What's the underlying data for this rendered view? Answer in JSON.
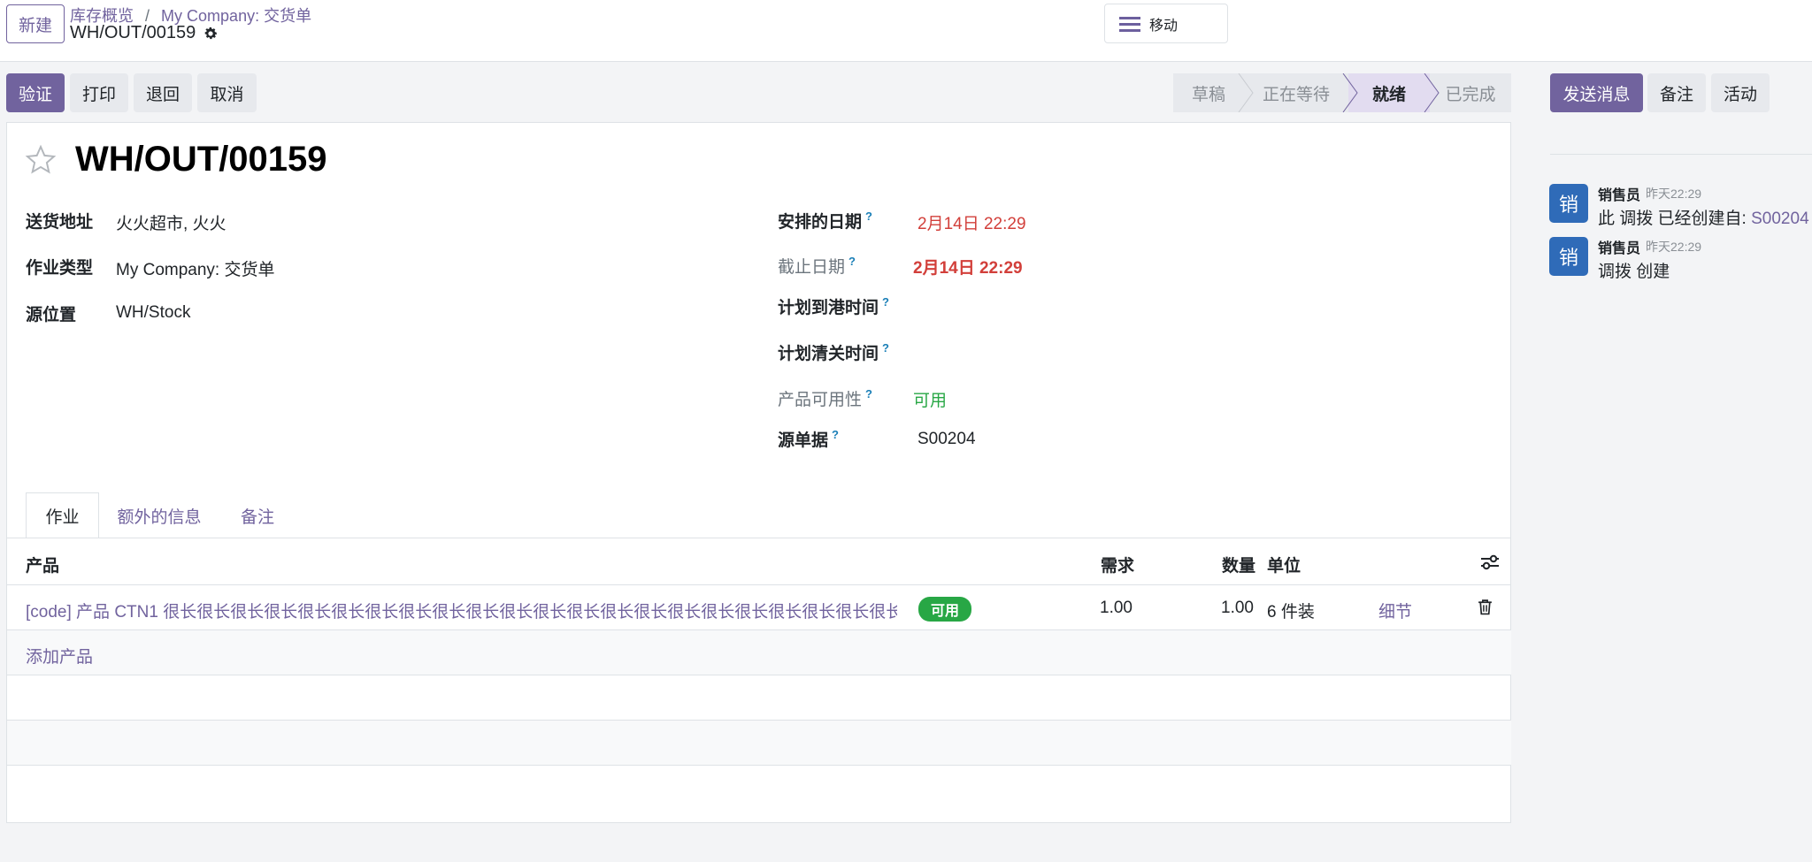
{
  "header": {
    "new_button": "新建",
    "breadcrumb_parent": "库存概览",
    "breadcrumb_sep": "/",
    "breadcrumb_current": "My Company: 交货单",
    "record_name": "WH/OUT/00159",
    "menu_label": "移动"
  },
  "actions": {
    "validate": "验证",
    "print": "打印",
    "return": "退回",
    "cancel": "取消"
  },
  "status": {
    "stages": [
      "草稿",
      "正在等待",
      "就绪",
      "已完成"
    ],
    "active": "就绪"
  },
  "chatter_buttons": {
    "send_message": "发送消息",
    "note": "备注",
    "activity": "活动"
  },
  "form": {
    "title": "WH/OUT/00159",
    "delivery_address_label": "送货地址",
    "delivery_address_value": "火火超市, 火火",
    "operation_type_label": "作业类型",
    "operation_type_value": "My Company: 交货单",
    "source_location_label": "源位置",
    "source_location_value": "WH/Stock",
    "scheduled_date_label": "安排的日期",
    "scheduled_date_value": "2月14日 22:29",
    "deadline_label": "截止日期",
    "deadline_value": "2月14日 22:29",
    "eta_label": "计划到港时间",
    "clearance_label": "计划清关时间",
    "availability_label": "产品可用性",
    "availability_value": "可用",
    "source_doc_label": "源单据",
    "source_doc_value": "S00204",
    "help_mark": "?"
  },
  "tabs": [
    "作业",
    "额外的信息",
    "备注"
  ],
  "table": {
    "headers": {
      "product": "产品",
      "demand": "需求",
      "quantity": "数量",
      "unit": "单位"
    },
    "rows": [
      {
        "product": "[code] 产品 CTN1 很长很长很长很长很长很长很长很长很长很长很长很长很长很长很长很长很长很长很长很长很长很长很长很长很...",
        "availability": "可用",
        "demand": "1.00",
        "quantity": "1.00",
        "unit": "6 件装",
        "detail": "细节"
      }
    ],
    "add_product": "添加产品"
  },
  "chatter": {
    "messages": [
      {
        "avatar": "销",
        "author": "销售员",
        "time": "昨天22:29",
        "text_prefix": "此 调拨 已经创建自: ",
        "link": "S00204"
      },
      {
        "avatar": "销",
        "author": "销售员",
        "time": "昨天22:29",
        "text_prefix": "调拨 创建",
        "link": ""
      }
    ]
  },
  "colors": {
    "primary": "#71639e",
    "danger": "#d23f3a",
    "success": "#28a745",
    "avatar": "#2f6bb8"
  }
}
